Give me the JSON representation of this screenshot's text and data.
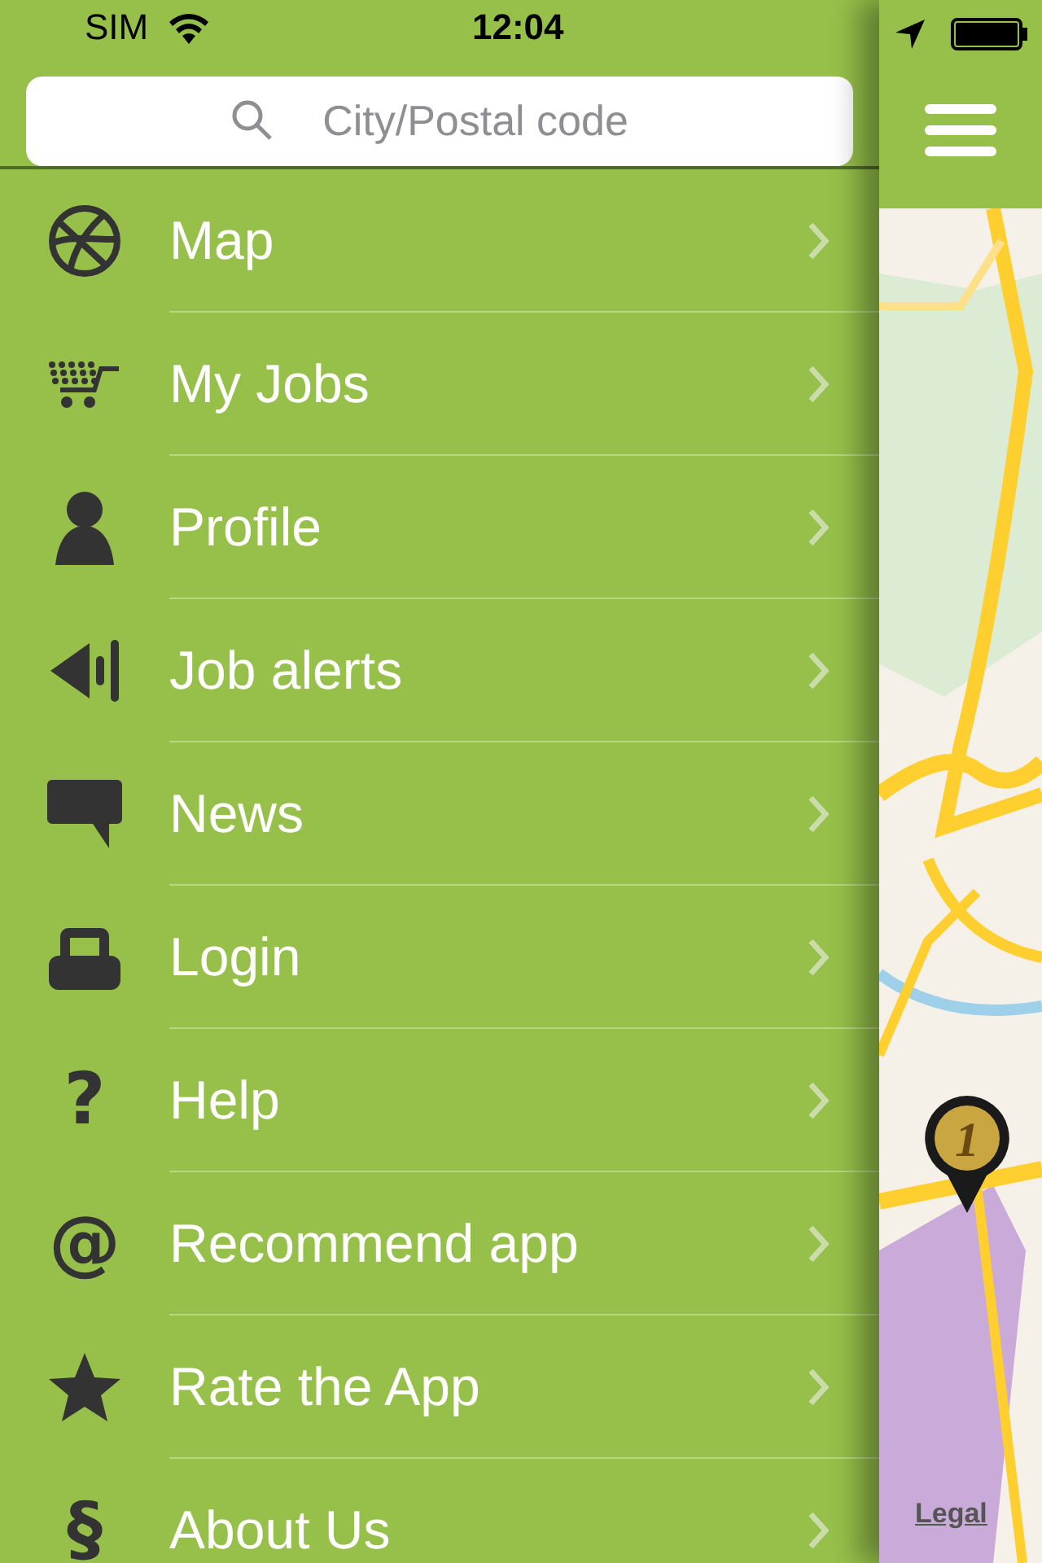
{
  "status_bar": {
    "carrier": "SIM",
    "time": "12:04"
  },
  "search": {
    "placeholder": "City/Postal code"
  },
  "menu": {
    "items": [
      {
        "kind": "globe",
        "label": "Map"
      },
      {
        "kind": "cart",
        "label": "My Jobs"
      },
      {
        "kind": "person",
        "label": "Profile"
      },
      {
        "kind": "alert",
        "label": "Job alerts"
      },
      {
        "kind": "speech",
        "label": "News"
      },
      {
        "kind": "lock",
        "label": "Login"
      },
      {
        "kind": "question",
        "glyph": "?",
        "label": "Help"
      },
      {
        "kind": "at",
        "glyph": "@",
        "label": "Recommend app"
      },
      {
        "kind": "star",
        "label": "Rate the App"
      },
      {
        "kind": "section",
        "glyph": "§",
        "label": "About Us"
      }
    ]
  },
  "map": {
    "pin": {
      "label": "1"
    },
    "legal_link": "Legal"
  }
}
